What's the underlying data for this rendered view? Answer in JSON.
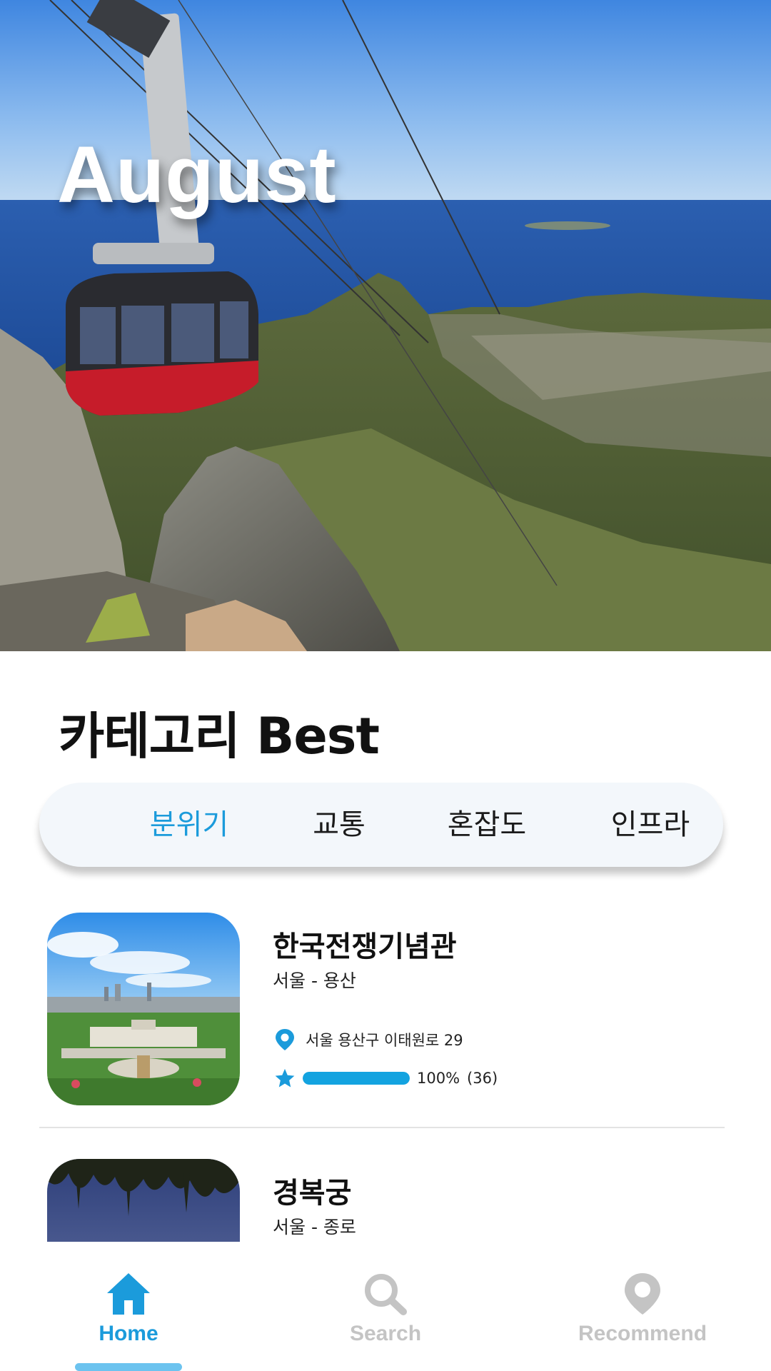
{
  "hero": {
    "title": "August"
  },
  "section": {
    "title": "카테고리 Best"
  },
  "tabs": [
    {
      "label": "분위기",
      "active": true
    },
    {
      "label": "교통",
      "active": false
    },
    {
      "label": "혼잡도",
      "active": false
    },
    {
      "label": "인프라",
      "active": false
    }
  ],
  "places": [
    {
      "name": "한국전쟁기념관",
      "region": "서울  -  용산",
      "address": "서울 용산구 이태원로 29",
      "rating_fraction": 1.0,
      "rating_percent": "100%",
      "rating_count": "(36)",
      "icons": {
        "location": "location-pin-icon",
        "rating": "star-icon"
      }
    },
    {
      "name": "경복궁",
      "region": "서울  -  종로"
    }
  ],
  "nav": {
    "items": [
      {
        "label": "Home",
        "icon": "home-icon",
        "active": true
      },
      {
        "label": "Search",
        "icon": "search-icon",
        "active": false
      },
      {
        "label": "Recommend",
        "icon": "location-pin-icon",
        "active": false
      }
    ]
  },
  "colors": {
    "accent": "#1b9bdb",
    "inactive_nav": "#c4c4c4",
    "tab_background": "#f3f7fb",
    "rating_bar": "#13a3e0"
  }
}
